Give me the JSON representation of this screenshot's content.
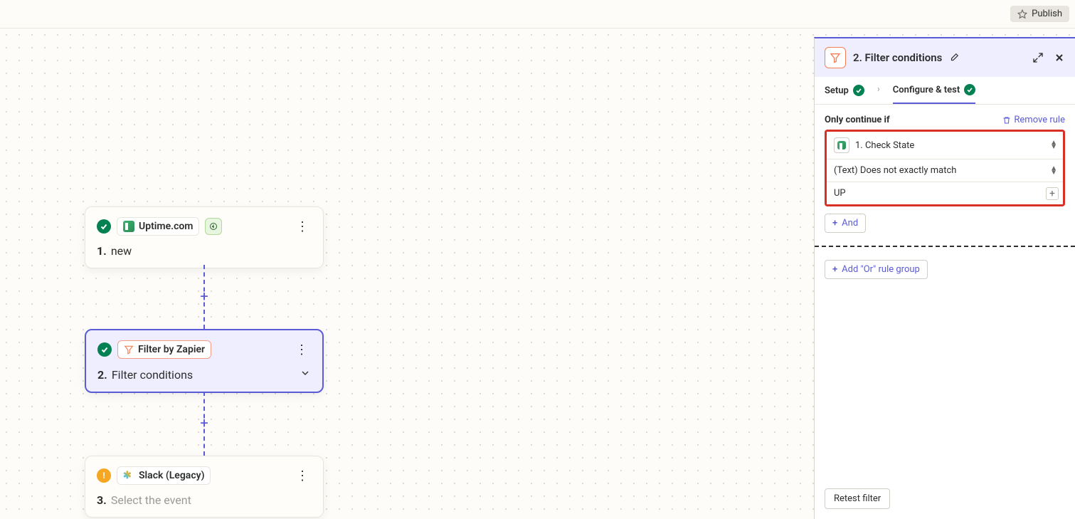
{
  "topbar": {
    "publish_label": "Publish"
  },
  "canvas": {
    "step1": {
      "app_name": "Uptime.com",
      "num": "1.",
      "title": "new"
    },
    "step2": {
      "app_name": "Filter by Zapier",
      "num": "2.",
      "title": "Filter conditions"
    },
    "step3": {
      "app_name": "Slack (Legacy)",
      "num": "3.",
      "title": "Select the event"
    }
  },
  "panel": {
    "title": "2. Filter conditions",
    "tabs": {
      "setup": "Setup",
      "configure": "Configure & test"
    },
    "continue_label": "Only continue if",
    "remove_rule_label": "Remove rule",
    "rule": {
      "field": "1. Check State",
      "condition": "(Text) Does not exactly match",
      "value": "UP"
    },
    "and_label": "And",
    "or_label": "Add \"Or\" rule group",
    "retest_label": "Retest filter"
  }
}
